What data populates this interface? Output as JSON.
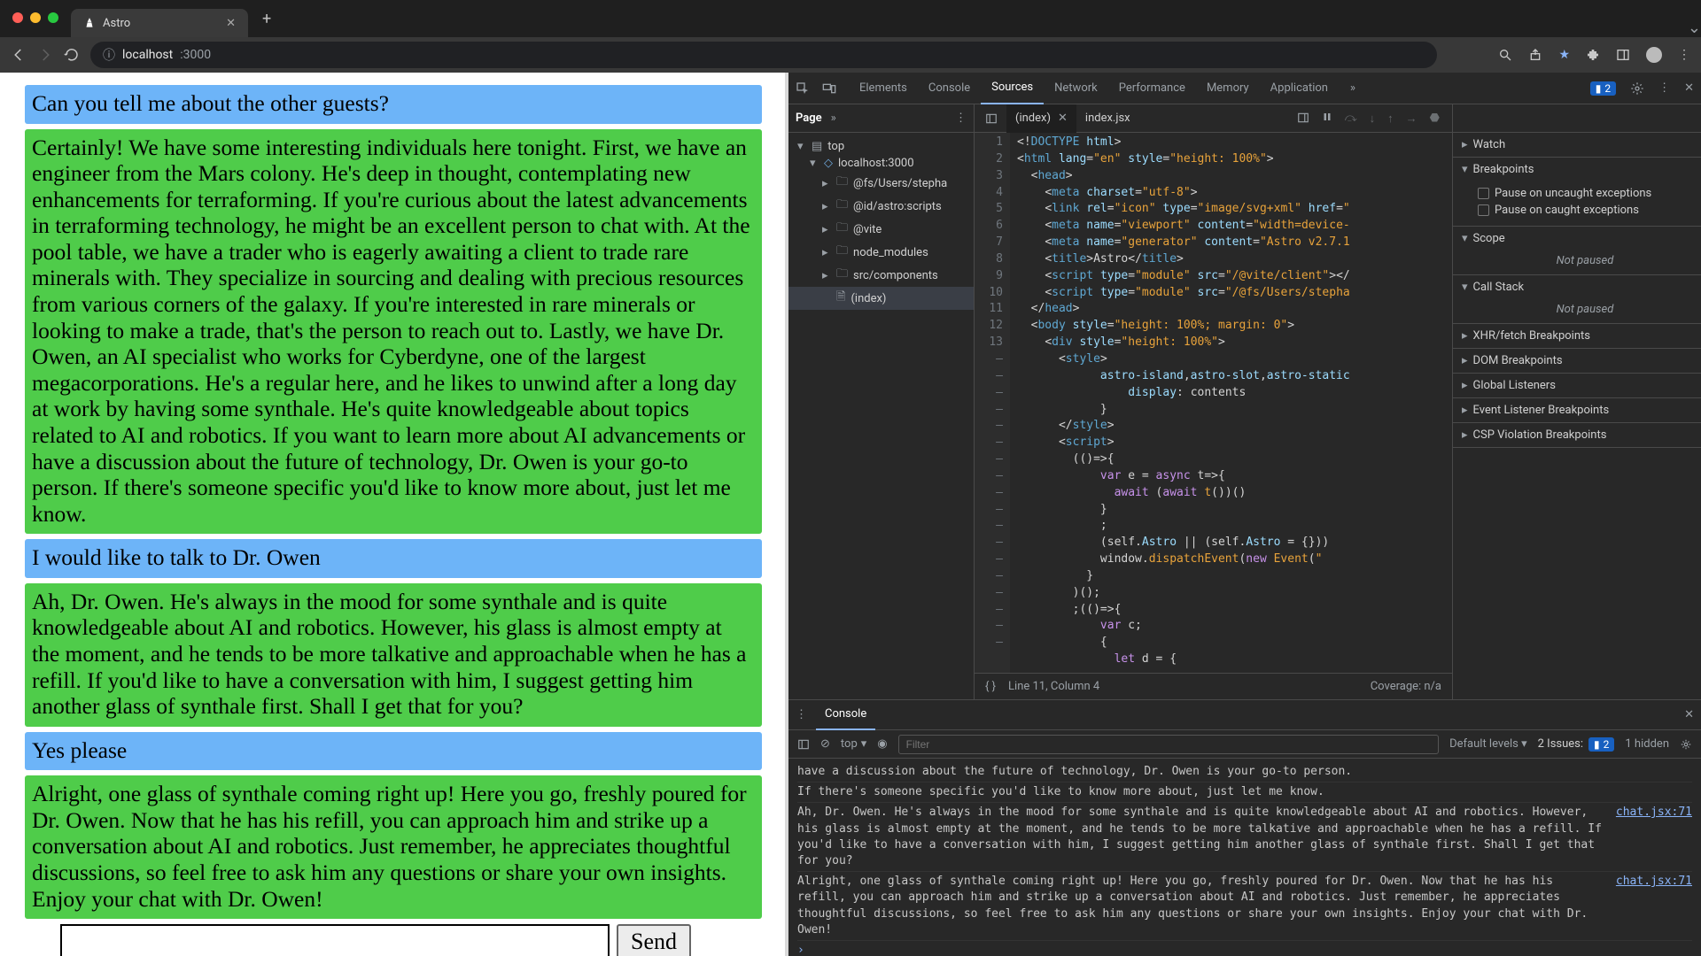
{
  "browser": {
    "tab_title": "Astro",
    "url_host": "localhost",
    "url_port": ":3000"
  },
  "chat": {
    "messages": [
      {
        "role": "user",
        "text": "Can you tell me about the other guests?"
      },
      {
        "role": "bot",
        "text": "Certainly! We have some interesting individuals here tonight. First, we have an engineer from the Mars colony. He's deep in thought, contemplating new enhancements for terraforming. If you're curious about the latest advancements in terraforming technology, he might be an excellent person to chat with. At the pool table, we have a trader who is eagerly awaiting a client to trade rare minerals with. They specialize in sourcing and dealing with precious resources from various corners of the galaxy. If you're interested in rare minerals or looking to make a trade, that's the person to reach out to. Lastly, we have Dr. Owen, an AI specialist who works for Cyberdyne, one of the largest megacorporations. He's a regular here, and he likes to unwind after a long day at work by having some synthale. He's quite knowledgeable about topics related to AI and robotics. If you want to learn more about AI advancements or have a discussion about the future of technology, Dr. Owen is your go-to person. If there's someone specific you'd like to know more about, just let me know."
      },
      {
        "role": "user",
        "text": "I would like to talk to Dr. Owen"
      },
      {
        "role": "bot",
        "text": "Ah, Dr. Owen. He's always in the mood for some synthale and is quite knowledgeable about AI and robotics. However, his glass is almost empty at the moment, and he tends to be more talkative and approachable when he has a refill. If you'd like to have a conversation with him, I suggest getting him another glass of synthale first. Shall I get that for you?"
      },
      {
        "role": "user",
        "text": "Yes please"
      },
      {
        "role": "bot",
        "text": "Alright, one glass of synthale coming right up! Here you go, freshly poured for Dr. Owen. Now that he has his refill, you can approach him and strike up a conversation about AI and robotics. Just remember, he appreciates thoughtful discussions, so feel free to ask him any questions or share your own insights. Enjoy your chat with Dr. Owen!"
      }
    ],
    "send_label": "Send",
    "input_value": ""
  },
  "devtools": {
    "tabs": [
      "Elements",
      "Console",
      "Sources",
      "Network",
      "Performance",
      "Memory",
      "Application"
    ],
    "active_tab": "Sources",
    "issue_badge": "2",
    "file_nav": {
      "tab": "Page",
      "tree": {
        "top": "top",
        "host": "localhost:3000",
        "folders": [
          "@fs/Users/stepha",
          "@id/astro:scripts",
          "@vite",
          "node_modules",
          "src/components"
        ],
        "open_file": "(index)"
      }
    },
    "editor": {
      "tabs": [
        {
          "name": "(index)",
          "active": true,
          "closeable": true
        },
        {
          "name": "index.jsx",
          "active": false,
          "closeable": false
        }
      ],
      "gutter": [
        "1",
        "2",
        "3",
        "4",
        "5",
        "6",
        "7",
        "8",
        "9",
        "10",
        "11",
        "12",
        "13",
        "–",
        "–",
        "–",
        "–",
        "–",
        "–",
        "–",
        "–",
        "–",
        "–",
        "–",
        "–",
        "–",
        "–",
        "–",
        "–",
        "–",
        "–"
      ],
      "status_cursor": "Line 11, Column 4",
      "status_coverage": "Coverage: n/a"
    },
    "debug": {
      "watch": "Watch",
      "breakpoints": {
        "label": "Breakpoints",
        "pause_uncaught": "Pause on uncaught exceptions",
        "pause_caught": "Pause on caught exceptions"
      },
      "scope": {
        "label": "Scope",
        "body": "Not paused"
      },
      "callstack": {
        "label": "Call Stack",
        "body": "Not paused"
      },
      "sections": [
        "XHR/fetch Breakpoints",
        "DOM Breakpoints",
        "Global Listeners",
        "Event Listener Breakpoints",
        "CSP Violation Breakpoints"
      ]
    },
    "console": {
      "drawer_tab": "Console",
      "context": "top",
      "filter_placeholder": "Filter",
      "levels": "Default levels",
      "issues_label": "2 Issues:",
      "issues_count": "2",
      "hidden": "1 hidden",
      "logs": [
        {
          "text": "have a discussion about the future of technology, Dr. Owen is your go-to person.",
          "src": ""
        },
        {
          "text": "If there's someone specific you'd like to know more about, just let me know.",
          "src": ""
        },
        {
          "text": "Ah, Dr. Owen. He's always in the mood for some synthale and is quite knowledgeable about AI and robotics. However, his glass is almost empty at the moment, and he tends to be more talkative and approachable when he has a refill. If you'd like to have a conversation with him, I suggest getting him another glass of synthale first. Shall I get that for you?",
          "src": "chat.jsx:71"
        },
        {
          "text": "Alright, one glass of synthale coming right up! Here you go, freshly poured for Dr. Owen. Now that he has his refill, you can approach him and strike up a conversation about AI and robotics. Just remember, he appreciates thoughtful discussions, so feel free to ask him any questions or share your own insights. Enjoy your chat with Dr. Owen!",
          "src": "chat.jsx:71"
        }
      ]
    }
  }
}
